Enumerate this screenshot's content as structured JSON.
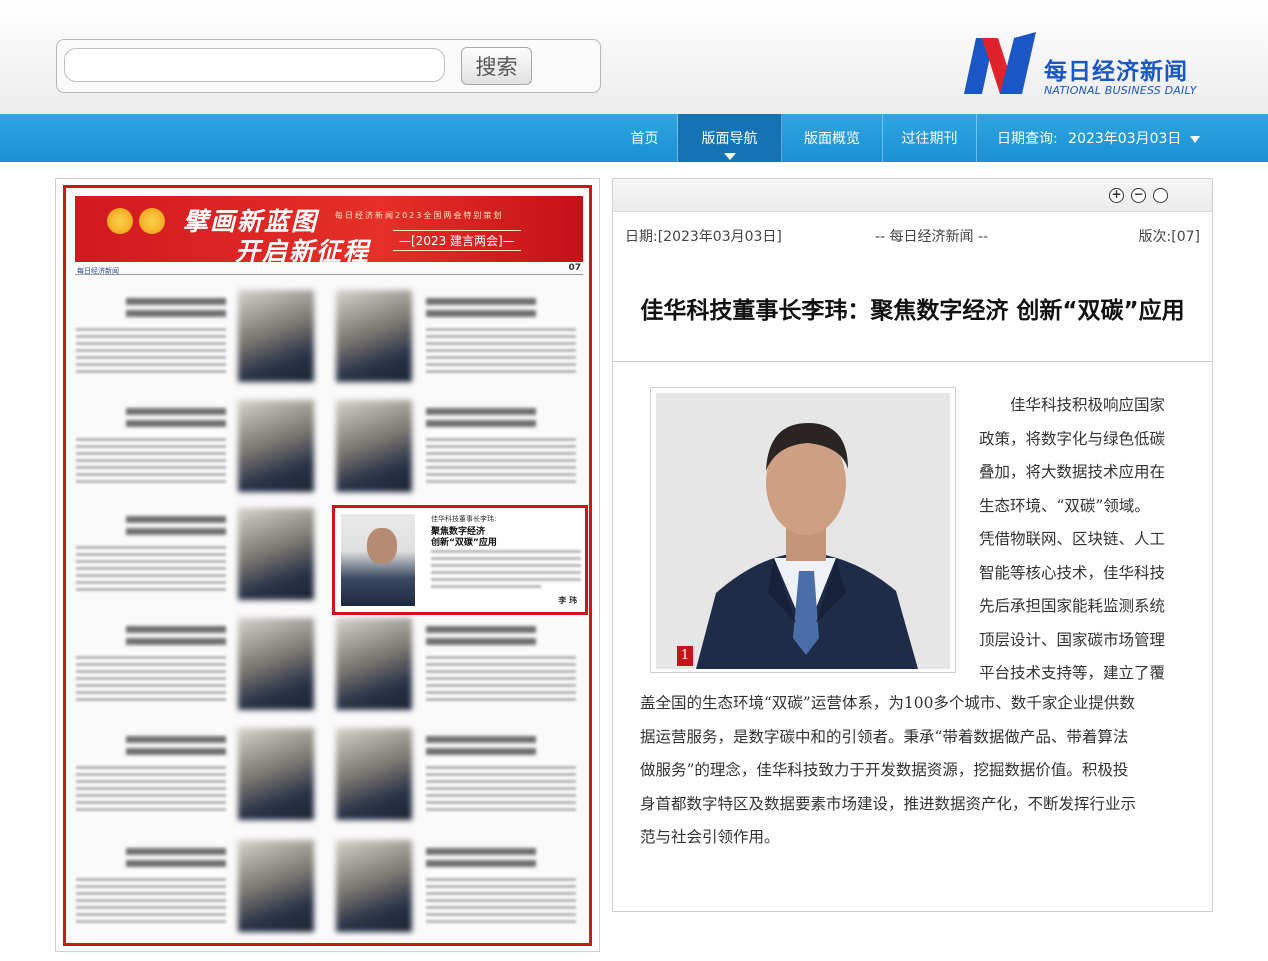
{
  "search": {
    "value": "",
    "button_label": "搜索"
  },
  "logo": {
    "cn": "每日经济新闻",
    "en": "NATIONAL BUSINESS DAILY",
    "colors": {
      "blue": "#1a57c4",
      "red": "#e0232b"
    }
  },
  "nav": {
    "items": [
      {
        "label": "首页",
        "active": false
      },
      {
        "label": "版面导航",
        "active": true
      },
      {
        "label": "版面概览",
        "active": false
      },
      {
        "label": "过往期刊",
        "active": false
      }
    ],
    "date_label": "日期查询:",
    "date_value": "2023年03月03日"
  },
  "page_thumb": {
    "banner_line1": "擘画新蓝图",
    "banner_line2": "开启新征程",
    "banner_small": "每日经济新闻2023全国两会特别策划",
    "banner_tag": "—[2023 建言两会]—",
    "strip_left": "每日经济新闻",
    "page_no": "07",
    "highlight": {
      "title_small": "佳华科技董事长李玮:",
      "title_big1": "聚焦数字经济",
      "title_big2": "创新“双碳”应用",
      "signature": "李 玮"
    }
  },
  "article": {
    "toolbar": {
      "zoom_in": "+",
      "zoom_out": "−",
      "reset": ""
    },
    "date": "日期:[2023年03月03日]",
    "source": "-- 每日经济新闻 --",
    "edition": "版次:[07]",
    "title": "佳华科技董事长李玮：聚焦数字经济 创新“双碳”应用",
    "figure_badge": "1",
    "paragraph_float": [
      "佳华科技积极响应国家",
      "政策，将数字化与绿色低碳",
      "叠加，将大数据技术应用在",
      "生态环境、“双碳”领域。",
      "凭借物联网、区块链、人工",
      "智能等核心技术，佳华科技",
      "先后承担国家能耗监测系统",
      "顶层设计、国家碳市场管理",
      "平台技术支持等，建立了覆"
    ],
    "paragraph_full": [
      "盖全国的生态环境“双碳”运营体系，为100多个城市、数千家企业提供数",
      "据运营服务，是数字碳中和的引领者。秉承“带着数据做产品、带着算法",
      "做服务”的理念，佳华科技致力于开发数据资源，挖掘数据价值。积极投",
      "身首都数字特区及数据要素市场建设，推进数据资产化，不断发挥行业示",
      "范与社会引领作用。"
    ]
  },
  "colors": {
    "nav_blue": "#1c8fd1",
    "nav_active": "#1673b3",
    "highlight_red": "#d4141b"
  }
}
